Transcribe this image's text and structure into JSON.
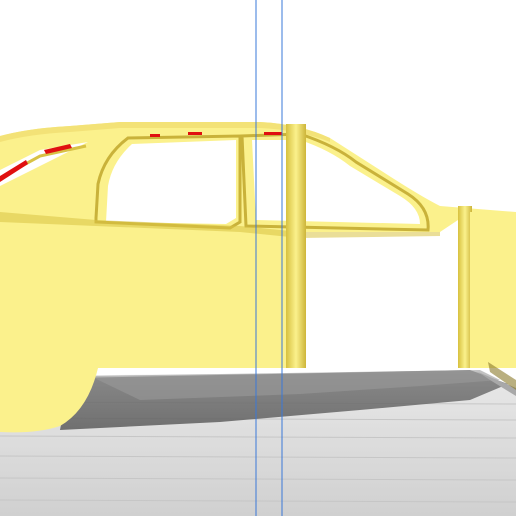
{
  "viewport": {
    "kind": "3d-slicer-preview",
    "background_color": "#ffffff",
    "build_plate_color": "#d9d9d9",
    "plate_grid_color": "#c9c9c9",
    "model_color": "#fbf18c",
    "model_shadow_color": "#d8c244",
    "layer_edge_color": "#e8e6b0",
    "overhang_highlight_color": "#e01010",
    "axis_line_color": "#3a78d8"
  },
  "model": {
    "name_icon": "car-body-icon"
  }
}
